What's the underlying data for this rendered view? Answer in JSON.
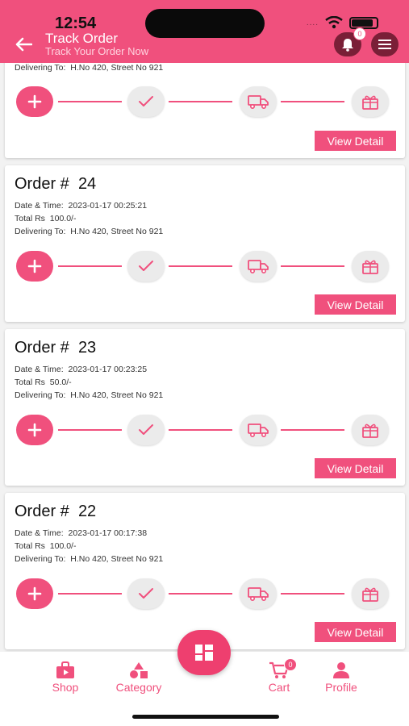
{
  "status_bar": {
    "time": "12:54",
    "signal": "...."
  },
  "header": {
    "title": "Track Order",
    "subtitle": "Track Your Order Now",
    "notification_count": "0"
  },
  "labels": {
    "order_prefix": "Order #",
    "date_label": "Date & Time:",
    "total_label": "Total Rs",
    "delivering_label": "Delivering To:",
    "view_detail": "View Detail"
  },
  "partial_order": {
    "delivering_to": "H.No 420, Street No 921"
  },
  "orders": [
    {
      "number": "24",
      "datetime": "2023-01-17 00:25:21",
      "total": "100.0/-",
      "delivering_to": "H.No 420, Street No 921"
    },
    {
      "number": "23",
      "datetime": "2023-01-17 00:23:25",
      "total": "50.0/-",
      "delivering_to": "H.No 420, Street No 921"
    },
    {
      "number": "22",
      "datetime": "2023-01-17 00:17:38",
      "total": "100.0/-",
      "delivering_to": "H.No 420, Street No 921"
    }
  ],
  "tracker_steps": [
    "add-icon",
    "check-icon",
    "truck-icon",
    "gift-icon"
  ],
  "bottom_nav": {
    "shop": "Shop",
    "category": "Category",
    "cart": "Cart",
    "cart_count": "0",
    "profile": "Profile"
  },
  "colors": {
    "accent": "#f0507d",
    "header_button": "#7a1f37"
  }
}
